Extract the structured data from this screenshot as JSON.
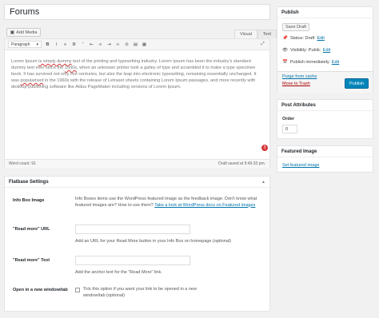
{
  "post": {
    "title": "Forums"
  },
  "media": {
    "add_media_label": "Add Media"
  },
  "editor": {
    "tabs": [
      "Visual",
      "Text"
    ],
    "format_select": "Paragraph",
    "content_segments": [
      "Lorem Ipsum ",
      "is simply dummy",
      " text of the printing and typesetting industry. Lorem Ipsum has been the industry's standard dummy text ever since the ",
      "1500s",
      ", when an unknown printer took a galley of type and scrambled it to make a type specimen book. It has survived not only five centuries, but also the leap into electronic typesetting, remaining essentially unchanged. It was ",
      "popularised",
      " in the 1960s with the release of Letraset sheets containing Lorem Ipsum passages, and more recently with desktop publishing software like Aldus PageMaker including versions of Lorem Ipsum."
    ],
    "spellcheck_count": "3",
    "word_count": "Word count: 91",
    "draft_saved": "Draft saved at 9:49:33 pm."
  },
  "flatbase": {
    "header": "Flatbase Settings",
    "info_box": {
      "label": "Info Box Image",
      "desc": "Info Boxes items use the WordPress featured image as the feedback image. Don't know what featured images are? How to use them? ",
      "link": "Take a look at WordPress docs on Featured images"
    },
    "read_more_url": {
      "label": "\"Read more\" URL",
      "value": "",
      "help": "Add an URL for your Read More button in your Info Box on homepage (optional)"
    },
    "read_more_text": {
      "label": "\"Read more\" Text",
      "value": "",
      "help": "Add the anchor text for the \"Read More\" link."
    },
    "new_window": {
      "label": "Open in a new window/tab",
      "help": "Tick this option if you want your link to be opened in a new window/tab (optional)",
      "checked": false
    }
  },
  "publish": {
    "header": "Publish",
    "save_draft": "Save Draft",
    "status_label": "Status: Draft",
    "visibility_label": "Visibility: Public",
    "schedule_label": "Publish immediately",
    "edit": "Edit",
    "purge": "Purge from cache",
    "trash": "Move to Trash",
    "publish_btn": "Publish"
  },
  "post_attributes": {
    "header": "Post Attributes",
    "order_label": "Order",
    "order_value": "0"
  },
  "featured_image": {
    "header": "Featured Image",
    "set_link": "Set featured image"
  },
  "colors": {
    "accent": "#0085ba",
    "link": "#0073aa",
    "trash": "#a00",
    "badge": "#d63638"
  }
}
